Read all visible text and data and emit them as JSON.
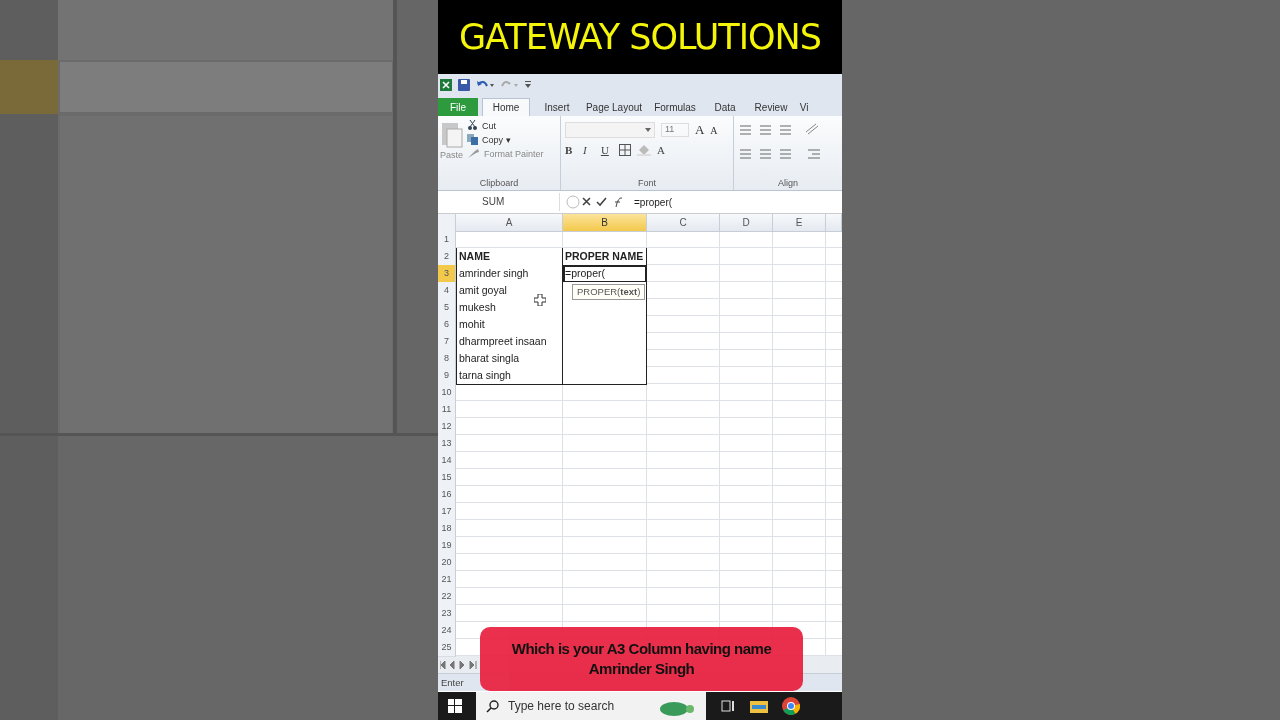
{
  "banner": {
    "title": "GATEWAY SOLUTIONS"
  },
  "ribbon": {
    "tabs": [
      {
        "label": "File",
        "kind": "file",
        "selected": false
      },
      {
        "label": "Home",
        "kind": "tab",
        "selected": true
      },
      {
        "label": "Insert",
        "kind": "tab",
        "selected": false
      },
      {
        "label": "Page Layout",
        "kind": "tab",
        "selected": false
      },
      {
        "label": "Formulas",
        "kind": "tab",
        "selected": false
      },
      {
        "label": "Data",
        "kind": "tab",
        "selected": false
      },
      {
        "label": "Review",
        "kind": "tab",
        "selected": false
      },
      {
        "label": "Vi",
        "kind": "tab",
        "selected": false
      }
    ],
    "clipboard": {
      "paste": "Paste",
      "cut": "Cut",
      "copy": "Copy ▾",
      "format_painter": "Format Painter",
      "label": "Clipboard"
    },
    "font": {
      "size": "11",
      "grow": "A",
      "shrink": "A",
      "bold": "B",
      "italic": "I",
      "underline": "U",
      "font_color_button": "A",
      "label": "Font"
    },
    "alignment": {
      "label": "Align"
    }
  },
  "formula_bar": {
    "name_box": "SUM",
    "formula": "=proper("
  },
  "sheet": {
    "columns": [
      {
        "label": "A",
        "selected": false
      },
      {
        "label": "B",
        "selected": true
      },
      {
        "label": "C",
        "selected": false
      },
      {
        "label": "D",
        "selected": false
      },
      {
        "label": "E",
        "selected": false
      }
    ],
    "tooltip": "PROPER(**text**)",
    "rows": [
      {
        "num": "1",
        "selected": false,
        "bordered": false
      },
      {
        "num": "2",
        "selected": false,
        "bordered": true,
        "a": "NAME",
        "b": "PROPER NAME",
        "header": true
      },
      {
        "num": "3",
        "selected": true,
        "bordered": true,
        "a": "amrinder singh",
        "b": "=proper("
      },
      {
        "num": "4",
        "selected": false,
        "bordered": true,
        "a": "amit goyal"
      },
      {
        "num": "5",
        "selected": false,
        "bordered": true,
        "a": "mukesh"
      },
      {
        "num": "6",
        "selected": false,
        "bordered": true,
        "a": "mohit"
      },
      {
        "num": "7",
        "selected": false,
        "bordered": true,
        "a": "dharmpreet insaan"
      },
      {
        "num": "8",
        "selected": false,
        "bordered": true,
        "a": "bharat singla"
      },
      {
        "num": "9",
        "selected": false,
        "bordered": true,
        "a": "tarna singh"
      },
      {
        "num": "10",
        "selected": false,
        "bordered": false
      },
      {
        "num": "11",
        "selected": false,
        "bordered": false
      },
      {
        "num": "12",
        "selected": false,
        "bordered": false
      },
      {
        "num": "13",
        "selected": false,
        "bordered": false
      },
      {
        "num": "14",
        "selected": false,
        "bordered": false
      },
      {
        "num": "15",
        "selected": false,
        "bordered": false
      },
      {
        "num": "16",
        "selected": false,
        "bordered": false
      },
      {
        "num": "17",
        "selected": false,
        "bordered": false
      },
      {
        "num": "18",
        "selected": false,
        "bordered": false
      },
      {
        "num": "19",
        "selected": false,
        "bordered": false
      },
      {
        "num": "20",
        "selected": false,
        "bordered": false
      },
      {
        "num": "21",
        "selected": false,
        "bordered": false
      },
      {
        "num": "22",
        "selected": false,
        "bordered": false
      },
      {
        "num": "23",
        "selected": false,
        "bordered": false
      },
      {
        "num": "24",
        "selected": false,
        "bordered": false
      },
      {
        "num": "25",
        "selected": false,
        "bordered": false
      }
    ]
  },
  "status_bar": {
    "mode": "Enter"
  },
  "taskbar": {
    "search": {
      "placeholder": "Type here to search"
    }
  },
  "caption": {
    "text": "Which is your A3 Column having name Amrinder Singh"
  }
}
